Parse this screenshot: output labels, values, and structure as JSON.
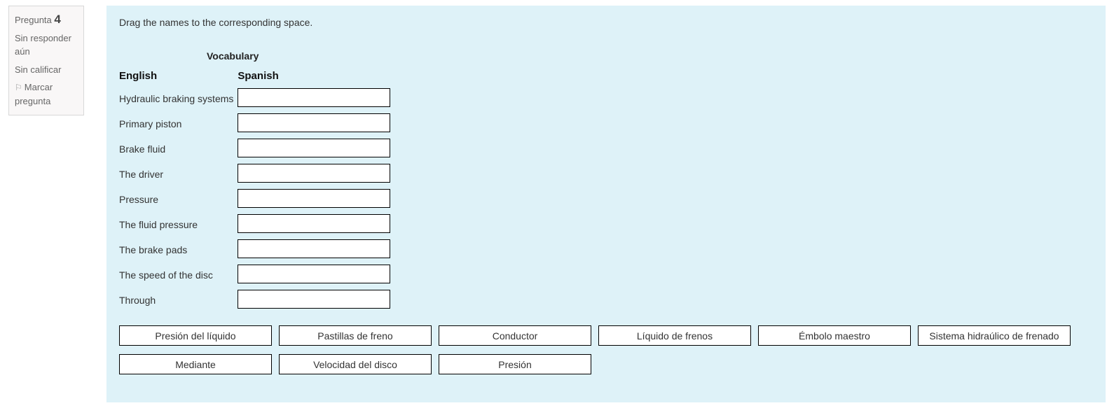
{
  "info": {
    "question_label": "Pregunta",
    "question_number": "4",
    "state_unanswered": "Sin responder aún",
    "state_grade": "Sin calificar",
    "flag_label": "Marcar pregunta"
  },
  "question": {
    "instruction": "Drag the names to the corresponding space.",
    "vocab_heading": "Vocabulary",
    "col_english": "English",
    "col_spanish": "Spanish",
    "rows": [
      "Hydraulic braking systems",
      "Primary piston",
      "Brake fluid",
      "The driver",
      "Pressure",
      "The fluid pressure",
      "The brake pads",
      "The speed of the disc",
      "Through"
    ],
    "drags_row1": [
      "Presión del líquido",
      "Pastillas de freno",
      "Conductor",
      "Líquido de frenos",
      "Émbolo maestro",
      "Sistema hidraúlico de frenado"
    ],
    "drags_row2": [
      "Mediante",
      "Velocidad del disco",
      "Presión"
    ]
  }
}
